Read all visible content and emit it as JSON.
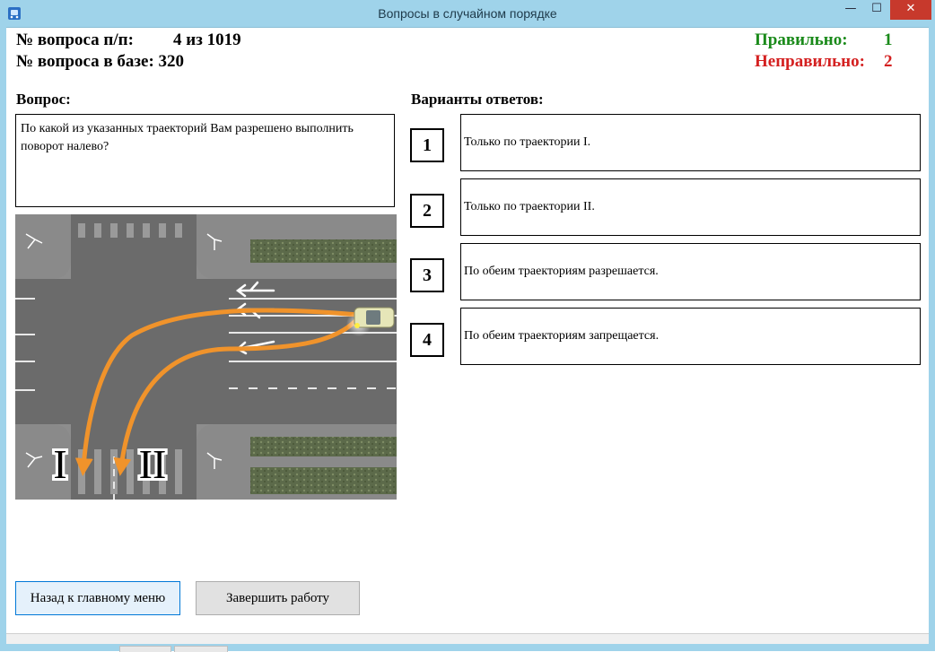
{
  "window": {
    "title": "Вопросы в случайном порядке",
    "minimize": "—",
    "maximize": "☐",
    "close": "✕"
  },
  "header": {
    "question_num_label": "№ вопроса п/п:",
    "question_num_value": "4 из 1019",
    "base_num_label": "№ вопроса в базе: 320",
    "correct_label": "Правильно:",
    "correct_value": "1",
    "wrong_label": "Неправильно:",
    "wrong_value": "2"
  },
  "question": {
    "title": "Вопрос:",
    "text": "По какой из указанных траекторий Вам разрешено выполнить поворот налево?",
    "image_labels": {
      "trajectory_1": "I",
      "trajectory_2": "II"
    }
  },
  "answers": {
    "title": "Варианты ответов:",
    "items": [
      {
        "number": "1",
        "text": "Только по траектории I."
      },
      {
        "number": "2",
        "text": "Только по траектории II."
      },
      {
        "number": "3",
        "text": "По обеим траекториям разрешается."
      },
      {
        "number": "4",
        "text": "По обеим траекториям запрещается."
      }
    ]
  },
  "buttons": {
    "back": "Назад к главному меню",
    "finish": "Завершить работу"
  },
  "colors": {
    "correct": "#1a8a1a",
    "wrong": "#d42020",
    "titlebar": "#9fd3ea",
    "trajectory": "#f0932b"
  }
}
